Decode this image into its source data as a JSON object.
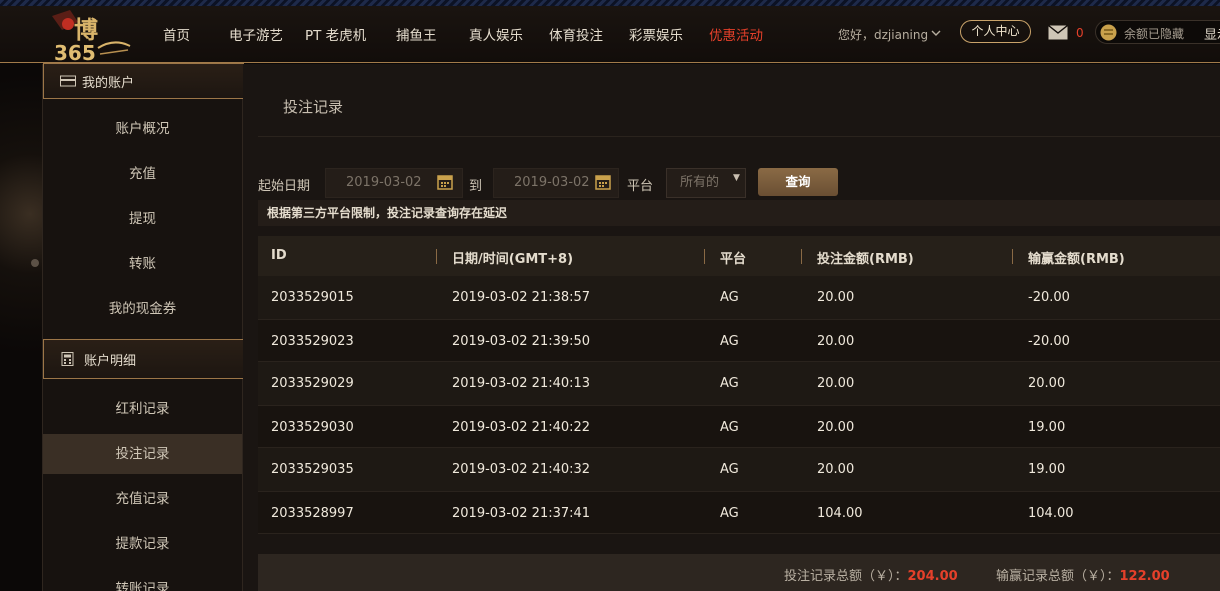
{
  "header": {
    "nav": [
      {
        "label": "首页",
        "name": "nav-home"
      },
      {
        "label": "电子游艺",
        "name": "nav-electronic-games"
      },
      {
        "label": "PT 老虎机",
        "name": "nav-pt-slots"
      },
      {
        "label": "捕鱼王",
        "name": "nav-fishing-king"
      },
      {
        "label": "真人娱乐",
        "name": "nav-live-casino"
      },
      {
        "label": "体育投注",
        "name": "nav-sports-betting"
      },
      {
        "label": "彩票娱乐",
        "name": "nav-lottery"
      },
      {
        "label": "优惠活动",
        "name": "nav-promotions"
      }
    ],
    "greeting": "您好，dzjianing",
    "personal_center": "个人中心",
    "mail_count": "0",
    "balance_text": "余额已隐藏",
    "show_text": "显示"
  },
  "sidebar": {
    "section1_title": "我的账户",
    "section1_items": [
      "账户概况",
      "充值",
      "提现",
      "转账",
      "我的现金券"
    ],
    "section2_title": "账户明细",
    "section2_items": [
      "红利记录",
      "投注记录",
      "充值记录",
      "提款记录",
      "转账记录"
    ],
    "active_item": "投注记录"
  },
  "main": {
    "title": "投注记录",
    "filters": {
      "start_label": "起始日期",
      "start_date": "2019-03-02",
      "to_label": "到",
      "end_date": "2019-03-02",
      "platform_label": "平台",
      "platform_value": "所有的",
      "query_button": "查询"
    },
    "notice": "根据第三方平台限制，投注记录查询存在延迟",
    "table": {
      "columns": [
        "ID",
        "日期/时间(GMT+8)",
        "平台",
        "投注金额(RMB)",
        "输赢金额(RMB)"
      ],
      "rows": [
        [
          "2033529015",
          "2019-03-02 21:38:57",
          "AG",
          "20.00",
          "-20.00"
        ],
        [
          "2033529023",
          "2019-03-02 21:39:50",
          "AG",
          "20.00",
          "-20.00"
        ],
        [
          "2033529029",
          "2019-03-02 21:40:13",
          "AG",
          "20.00",
          "20.00"
        ],
        [
          "2033529030",
          "2019-03-02 21:40:22",
          "AG",
          "20.00",
          "19.00"
        ],
        [
          "2033529035",
          "2019-03-02 21:40:32",
          "AG",
          "20.00",
          "19.00"
        ],
        [
          "2033528997",
          "2019-03-02 21:37:41",
          "AG",
          "104.00",
          "104.00"
        ]
      ]
    },
    "totals": {
      "bet_label": "投注记录总额（￥）：",
      "bet_total": "204.00",
      "win_label": "输赢记录总额（￥）：",
      "win_total": "122.00"
    }
  },
  "colors": {
    "accent_gold": "#a27b4a",
    "promo_red": "#e5402a",
    "background": "#1a1512"
  }
}
